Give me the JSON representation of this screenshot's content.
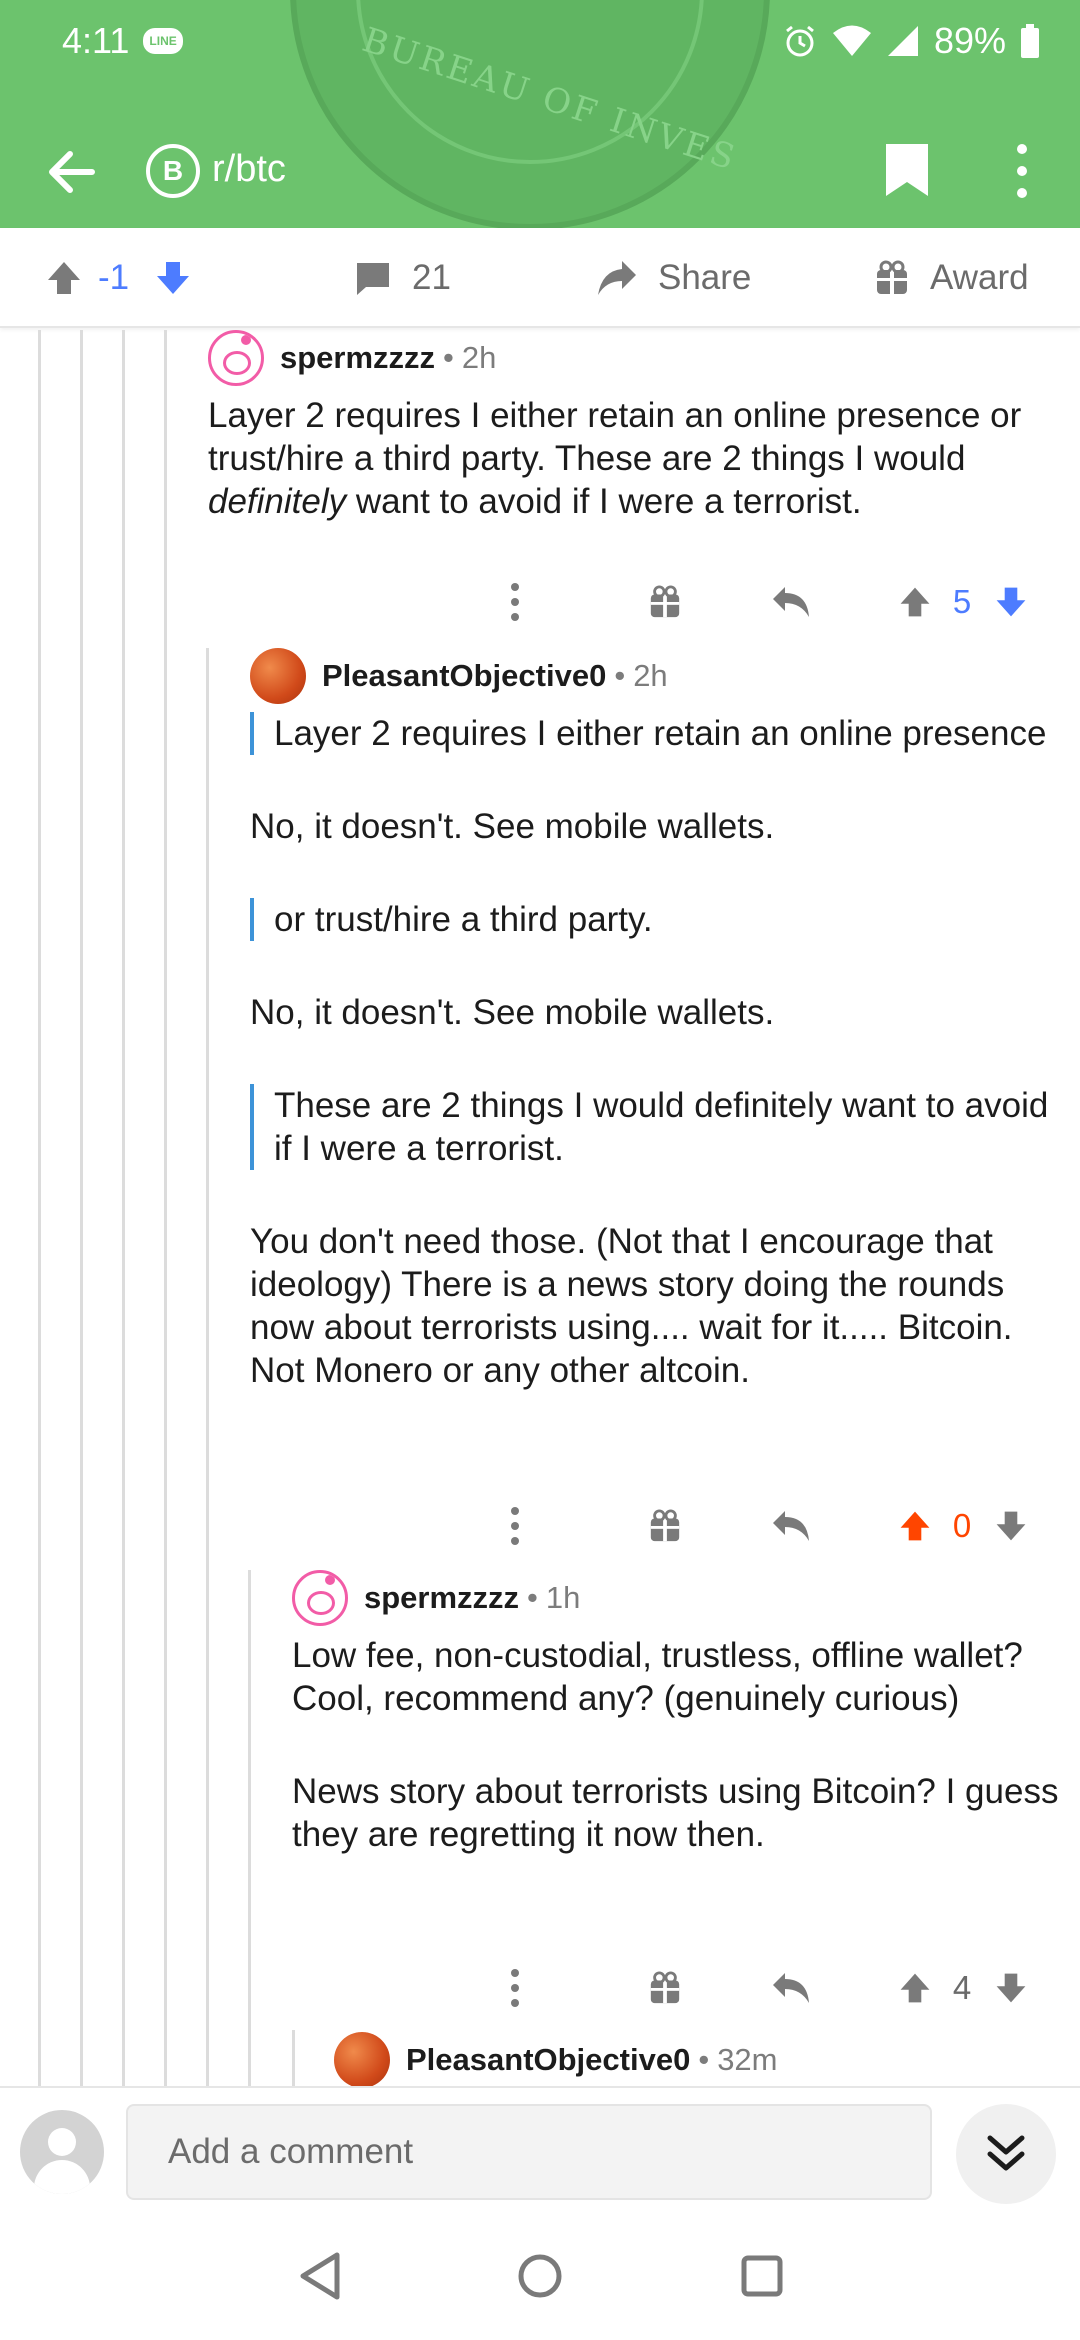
{
  "status_bar": {
    "time": "4:11",
    "notification_app": "LINE",
    "battery": "89%"
  },
  "header": {
    "subreddit": "r/btc",
    "subreddit_icon_glyph": "B",
    "background_text": "BUREAU OF INVES",
    "accent_color": "#6cc36d"
  },
  "post_bar": {
    "vote_score": "-1",
    "comment_count": "21",
    "share_label": "Share",
    "award_label": "Award"
  },
  "comments": [
    {
      "user": "spermzzzz",
      "time": "2h",
      "body_pre": "Layer 2 requires I either retain an online presence or trust/hire a third party. These are 2 things I would ",
      "body_em": "definitely",
      "body_post": " want to avoid if I were a terrorist.",
      "score": "5"
    },
    {
      "user": "PleasantObjective0",
      "time": "2h",
      "quote_1": "Layer 2 requires I either retain an online presence",
      "reply_1": "No, it doesn't.  See mobile wallets.",
      "quote_2": "or trust/hire a third party.",
      "reply_2": "No, it doesn't.  See mobile wallets.",
      "quote_3": "These are 2 things I would definitely want to avoid if I were a terrorist.",
      "reply_3": "You don't need those. (Not that I encourage that ideology)  There is a news story doing the rounds now about terrorists using.... wait for it..... Bitcoin.  Not Monero or any other altcoin.",
      "score": "0"
    },
    {
      "user": "spermzzzz",
      "time": "1h",
      "para_1": "Low fee, non-custodial, trustless, offline wallet? Cool, recommend any? (genuinely curious)",
      "para_2": "News story about terrorists using Bitcoin? I guess they are regretting it now then.",
      "score": "4"
    },
    {
      "user": "PleasantObjective0",
      "time": "32m"
    }
  ],
  "separator": "•",
  "comment_input": {
    "placeholder": "Add a comment"
  },
  "colors": {
    "upvote_active": "#ff4500",
    "downvote_active": "#7193ff",
    "quote_bar": "#3d93d8"
  }
}
